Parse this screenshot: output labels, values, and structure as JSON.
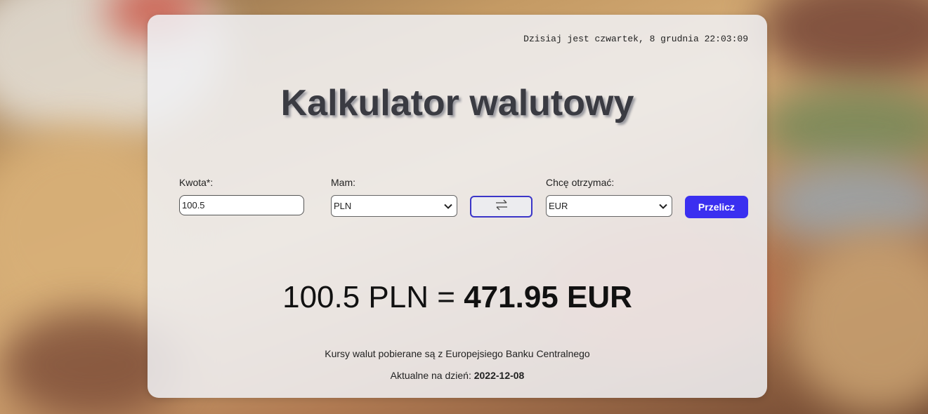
{
  "header": {
    "datetime": "Dzisiaj jest czwartek, 8 grudnia 22:03:09",
    "title": "Kalkulator walutowy"
  },
  "form": {
    "amount_label": "Kwota*:",
    "amount_value": "100.5",
    "have_label": "Mam:",
    "have_selected": "PLN",
    "want_label": "Chcę otrzymać:",
    "want_selected": "EUR",
    "swap_icon": "swap-arrows-icon",
    "calc_label": "Przelicz"
  },
  "result": {
    "from_text": "100.5 PLN =",
    "to_text": "471.95 EUR"
  },
  "footer": {
    "source_text": "Kursy walut pobierane są z Europejsiego Banku Centralnego",
    "updated_label": "Aktualne na dzień:",
    "updated_date": "2022-12-08"
  },
  "colors": {
    "accent": "#3a2ff0",
    "swap_border": "#3b36c8",
    "title": "#3a3b42"
  }
}
